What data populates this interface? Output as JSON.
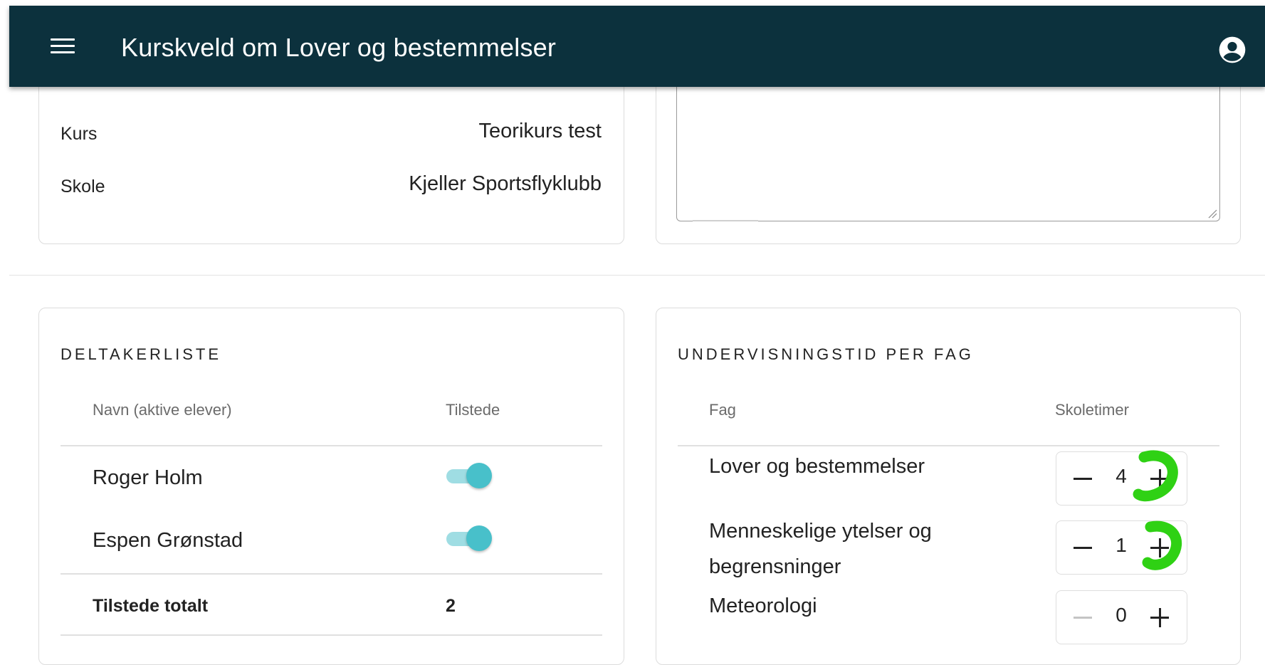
{
  "appbar": {
    "title": "Kurskveld om Lover og bestemmelser",
    "menu_icon": "menu-icon",
    "account_icon": "account-circle-icon",
    "color": "#0c313d"
  },
  "info": {
    "rows": [
      {
        "label": "Kurs",
        "value": "Teorikurs test"
      },
      {
        "label": "Skole",
        "value": "Kjeller Sportsflyklubb"
      }
    ]
  },
  "participants": {
    "title": "DELTAKERLISTE",
    "col_name": "Navn (aktive elever)",
    "col_present": "Tilstede",
    "students": [
      {
        "name": "Roger Holm",
        "present": true
      },
      {
        "name": "Espen Grønstad",
        "present": true
      }
    ],
    "total_label": "Tilstede totalt",
    "total_value": "2",
    "toggle_color": "#48c0ca"
  },
  "teaching": {
    "title": "UNDERVISNINGSTID PER FAG",
    "col_subject": "Fag",
    "col_hours": "Skoletimer",
    "subjects": [
      {
        "name": "Lover og bestemmelser",
        "hours": "4"
      },
      {
        "name": "Menneskelige ytelser og begrensninger",
        "hours": "1"
      },
      {
        "name": "Meteorologi",
        "hours": "0"
      }
    ],
    "annotation_color": "#2fd114"
  }
}
